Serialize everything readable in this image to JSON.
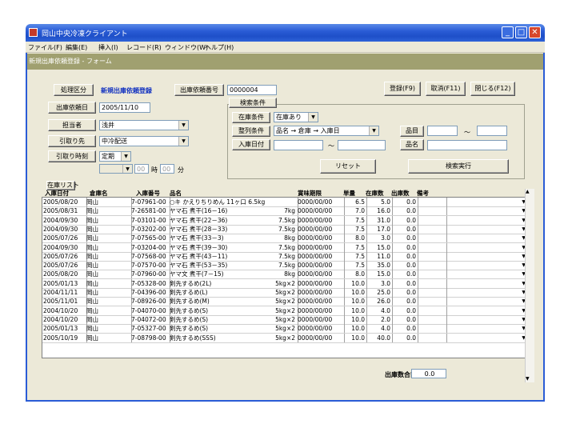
{
  "window": {
    "title": "岡山中央冷凍クライアント",
    "buttons": [
      "_",
      "□",
      "✕"
    ]
  },
  "menu": [
    "ファイル(F)",
    "編集(E)",
    "挿入(I)",
    "レコード(R)",
    "ウィンドウ(W)",
    "ヘルプ(H)"
  ],
  "form_title": "新規出庫依頼登録 - フォーム",
  "header": {
    "process_label": "処理区分",
    "process_value": "新規出庫依頼登録",
    "order_no_label": "出庫依頼番号",
    "order_no_value": "0000004",
    "date_label": "出庫依頼日",
    "date_value": "2005/11/10",
    "person_label": "担当者",
    "person_value": "浅井",
    "dest_label": "引取り先",
    "dest_value": "中冷配送",
    "time_label": "引取り時刻",
    "time_value": "定期",
    "hour_value": "00",
    "hour_unit": "時",
    "min_value": "00",
    "min_unit": "分"
  },
  "search": {
    "group_label": "検索条件",
    "stock_label": "在庫条件",
    "stock_value": "在庫あり",
    "sort_label": "整列条件",
    "sort_value": "品名 → 倉庫 → 入庫日",
    "indate_label": "入庫日付",
    "tilde": "～",
    "item_label": "品目",
    "name_label": "品名",
    "reset": "リセット",
    "run": "検索実行"
  },
  "actions": {
    "register": "登録(F9)",
    "cancel": "取消(F11)",
    "close": "閉じる(F12)"
  },
  "list_label": "在庫リスト",
  "columns": [
    "入庫日付",
    "倉庫名",
    "入庫番号",
    "品名",
    "賞味期限",
    "単量",
    "在庫数",
    "出庫数",
    "備考"
  ],
  "rows": [
    [
      "2005/08/20",
      "岡山",
      "7-07961-00",
      "○キ かえりちりめん 11ヶ口 6.5kg",
      "0000/00/00",
      "6.5",
      "5.0",
      "0.0"
    ],
    [
      "2005/08/31",
      "岡山",
      "7-26581-00",
      "ヤマ石 煮干(16－16)",
      "7kg",
      "0000/00/00",
      "7.0",
      "16.0",
      "0.0"
    ],
    [
      "2004/09/30",
      "岡山",
      "7-03101-00",
      "ヤマ石 煮干(22－36)",
      "7.5kg",
      "0000/00/00",
      "7.5",
      "31.0",
      "0.0"
    ],
    [
      "2004/09/30",
      "岡山",
      "7-03202-00",
      "ヤマ石 煮干(28－33)",
      "7.5kg",
      "0000/00/00",
      "7.5",
      "17.0",
      "0.0"
    ],
    [
      "2005/07/26",
      "岡山",
      "7-07565-00",
      "ヤマ石 煮干(33－3)",
      "8kg",
      "0000/00/00",
      "8.0",
      "3.0",
      "0.0"
    ],
    [
      "2004/09/30",
      "岡山",
      "7-03204-00",
      "ヤマ石 煮干(39－30)",
      "7.5kg",
      "0000/00/00",
      "7.5",
      "15.0",
      "0.0"
    ],
    [
      "2005/07/26",
      "岡山",
      "7-07568-00",
      "ヤマ石 煮干(43－11)",
      "7.5kg",
      "0000/00/00",
      "7.5",
      "11.0",
      "0.0"
    ],
    [
      "2005/07/26",
      "岡山",
      "7-07570-00",
      "ヤマ石 煮干(53－35)",
      "7.5kg",
      "0000/00/00",
      "7.5",
      "35.0",
      "0.0"
    ],
    [
      "2005/08/20",
      "岡山",
      "7-07960-00",
      "ヤマ文 煮干(7－15)",
      "8kg",
      "0000/00/00",
      "8.0",
      "15.0",
      "0.0"
    ],
    [
      "2005/01/13",
      "岡山",
      "7-05328-00",
      "剣先するめ(2L)",
      "5kg×2",
      "0000/00/00",
      "10.0",
      "3.0",
      "0.0"
    ],
    [
      "2004/11/11",
      "岡山",
      "7-04396-00",
      "剣先するめ(L)",
      "5kg×2",
      "0000/00/00",
      "10.0",
      "25.0",
      "0.0"
    ],
    [
      "2005/11/01",
      "岡山",
      "7-08926-00",
      "剣先するめ(M)",
      "5kg×2",
      "0000/00/00",
      "10.0",
      "26.0",
      "0.0"
    ],
    [
      "2004/10/20",
      "岡山",
      "7-04070-00",
      "剣先するめ(S)",
      "5kg×2",
      "0000/00/00",
      "10.0",
      "4.0",
      "0.0"
    ],
    [
      "2004/10/20",
      "岡山",
      "7-04072-00",
      "剣先するめ(S)",
      "5kg×2",
      "0000/00/00",
      "10.0",
      "2.0",
      "0.0"
    ],
    [
      "2005/01/13",
      "岡山",
      "7-05327-00",
      "剣先するめ(S)",
      "5kg×2",
      "0000/00/00",
      "10.0",
      "4.0",
      "0.0"
    ],
    [
      "2005/10/19",
      "岡山",
      "7-08798-00",
      "剣先するめ(SSS)",
      "5kg×2",
      "0000/00/00",
      "10.0",
      "40.0",
      "0.0"
    ]
  ],
  "total": {
    "label": "出庫数合計",
    "value": "0.0"
  }
}
